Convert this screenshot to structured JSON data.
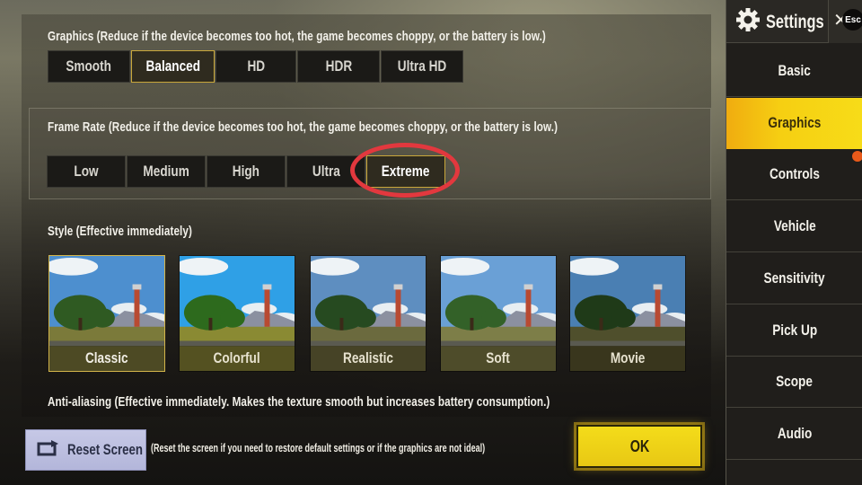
{
  "graphics": {
    "label": "Graphics (Reduce if the device becomes too hot, the game becomes choppy, or the battery is low.)",
    "options": [
      "Smooth",
      "Balanced",
      "HD",
      "HDR",
      "Ultra HD"
    ],
    "selected": "Balanced"
  },
  "frame_rate": {
    "label": "Frame Rate (Reduce if the device becomes too hot, the game becomes choppy, or the battery is low.)",
    "options": [
      "Low",
      "Medium",
      "High",
      "Ultra",
      "Extreme"
    ],
    "selected": "Extreme",
    "annotation": "red-circle-highlight"
  },
  "style": {
    "label": "Style (Effective immediately)",
    "options": [
      "Classic",
      "Colorful",
      "Realistic",
      "Soft",
      "Movie"
    ],
    "selected": "Classic"
  },
  "anti_aliasing": {
    "label": "Anti-aliasing (Effective immediately. Makes the texture smooth but increases battery consumption.)"
  },
  "footer": {
    "reset_label": "Reset Screen",
    "reset_note": "(Reset the screen if you need to restore default settings or if the graphics are not ideal)",
    "ok_label": "OK"
  },
  "sidebar": {
    "title": "Settings",
    "esc_label": "Esc",
    "items": [
      "Basic",
      "Graphics",
      "Controls",
      "Vehicle",
      "Sensitivity",
      "Pick Up",
      "Scope",
      "Audio"
    ],
    "active": "Graphics"
  },
  "colors": {
    "accent_yellow": "#f6cf12",
    "selected_border": "#c9a73a",
    "highlight_red": "#e2383e",
    "notification_dot": "#e85a1a",
    "reset_button": "#c0c2e2"
  }
}
